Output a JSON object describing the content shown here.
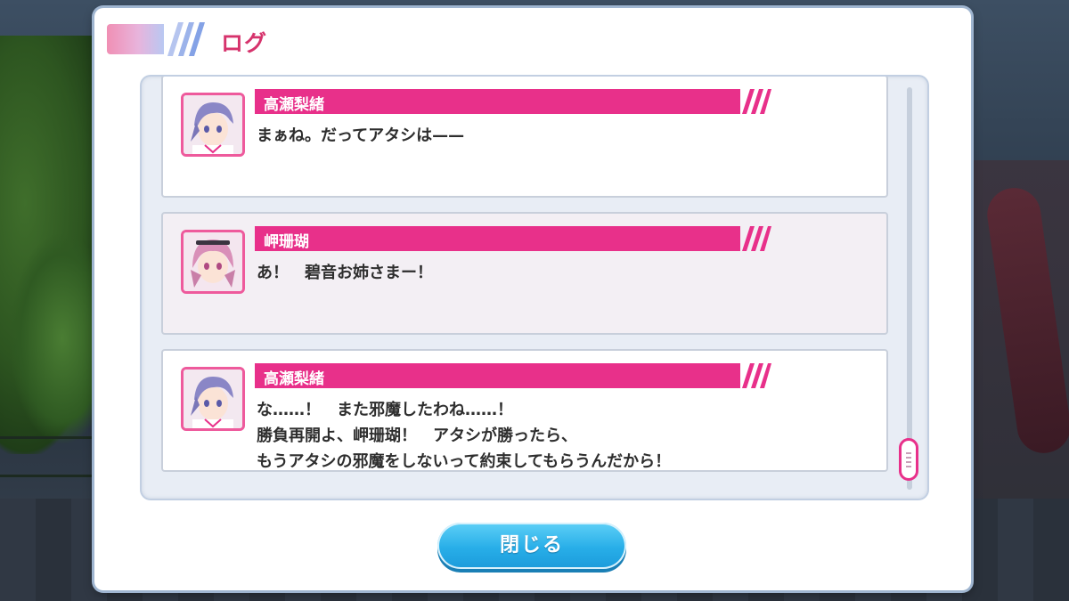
{
  "dialog_title": "ログ",
  "entries": [
    {
      "speaker": "高瀬梨緒",
      "lines": [
        "まぁね。だってアタシは——"
      ],
      "avatar_icon": "character-portrait-purple-hair",
      "hair_color": "#8a86c6"
    },
    {
      "speaker": "岬珊瑚",
      "lines": [
        "あ！　碧音お姉さまー！"
      ],
      "avatar_icon": "character-portrait-pink-hair",
      "hair_color": "#d98fb8"
    },
    {
      "speaker": "高瀬梨緒",
      "lines": [
        "な……！　また邪魔したわね……！",
        "勝負再開よ、岬珊瑚！　アタシが勝ったら、",
        "もうアタシの邪魔をしないって約束してもらうんだから！"
      ],
      "avatar_icon": "character-portrait-purple-hair",
      "hair_color": "#8a86c6"
    }
  ],
  "close_button": {
    "label": "閉じる"
  },
  "colors": {
    "accent_pink": "#e8308a",
    "title_pink": "#d6336c",
    "button_blue": "#28aee8"
  }
}
